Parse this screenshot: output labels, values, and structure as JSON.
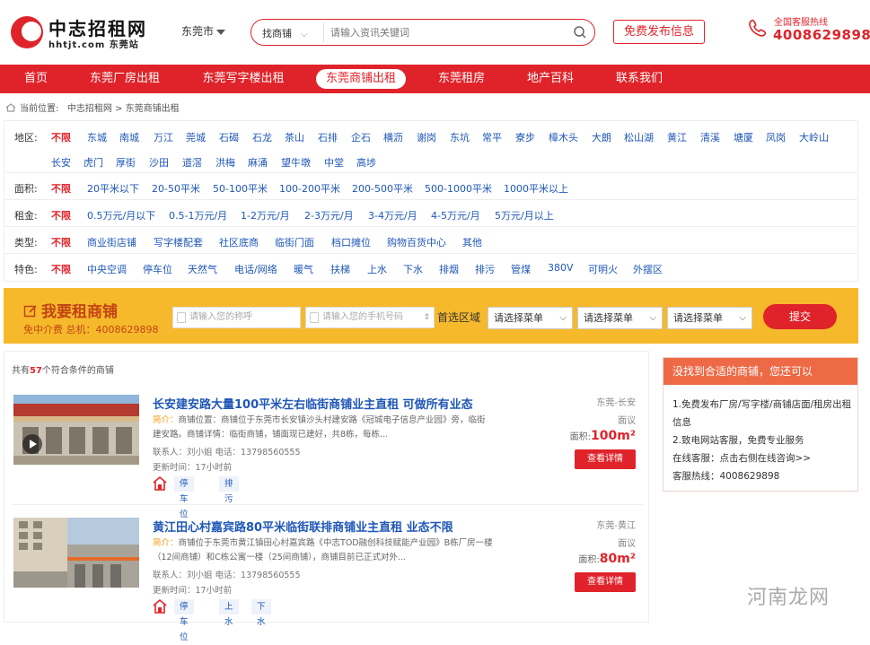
{
  "logo": {
    "title": "中志招租网",
    "sub": "hhtjt.com 东莞站"
  },
  "header": {
    "city": "东莞市",
    "search_type": "找商铺",
    "search_placeholder": "请输入资讯关键词",
    "publish": "免费发布信息",
    "hotline_label": "全国客服热线",
    "hotline": "4008629898"
  },
  "nav": [
    "首页",
    "东莞厂房出租",
    "东莞写字楼出租",
    "东莞商铺出租",
    "东莞租房",
    "地产百科",
    "联系我们"
  ],
  "breadcrumb": {
    "prefix": "当前位置:",
    "home": "中志招租网",
    "sep": ">",
    "current": "东莞商铺出租"
  },
  "filters": {
    "region": {
      "label": "地区:",
      "items": [
        "不限",
        "东城",
        "南城",
        "万江",
        "莞城",
        "石碣",
        "石龙",
        "茶山",
        "石排",
        "企石",
        "横沥",
        "谢岗",
        "东坑",
        "常平",
        "寮步",
        "樟木头",
        "大朗",
        "松山湖",
        "黄江",
        "清溪",
        "塘厦",
        "凤岗",
        "大岭山",
        "长安",
        "虎门",
        "厚街",
        "沙田",
        "道滘",
        "洪梅",
        "麻涌",
        "望牛墩",
        "中堂",
        "高埗"
      ]
    },
    "area": {
      "label": "面积:",
      "items": [
        "不限",
        "20平米以下",
        "20-50平米",
        "50-100平米",
        "100-200平米",
        "200-500平米",
        "500-1000平米",
        "1000平米以上"
      ]
    },
    "rent": {
      "label": "租金:",
      "items": [
        "不限",
        "0.5万元/月以下",
        "0.5-1万元/月",
        "1-2万元/月",
        "2-3万元/月",
        "3-4万元/月",
        "4-5万元/月",
        "5万元/月以上"
      ]
    },
    "type": {
      "label": "类型:",
      "items": [
        "不限",
        "商业街店铺",
        "写字楼配套",
        "社区底商",
        "临街门面",
        "档口摊位",
        "购物百货中心",
        "其他"
      ]
    },
    "feature": {
      "label": "特色:",
      "items": [
        "不限",
        "中央空调",
        "停车位",
        "天然气",
        "电话/网络",
        "暖气",
        "扶梯",
        "上水",
        "下水",
        "排烟",
        "排污",
        "管煤",
        "380V",
        "可明火",
        "外摆区"
      ]
    }
  },
  "banner": {
    "title": "我要租商铺",
    "sub": "免中介费 总机：4008629898",
    "name_ph": "请输入您的称呼",
    "phone_ph": "请输入您的手机号码",
    "region_label": "首选区域",
    "select": "请选择菜单",
    "submit": "提交"
  },
  "list": {
    "count_prefix": "共有",
    "count": "57",
    "count_suffix": "个符合条件的商铺"
  },
  "listings": [
    {
      "title": "长安建安路大量100平米左右临街商铺业主直租 可做所有业态",
      "desc_key": "简介：",
      "desc": "商铺位置：商铺位于东莞市长安镇沙头村建安路《冠城电子信息产业园》旁，临街建安路。商铺详情：临街商铺，铺面现已建好，共8栋，每栋...",
      "contact": "联系人：刘小姐 电话：13798560555",
      "time": "更新时间：17小时前",
      "tags": [
        "停车位",
        "排污"
      ],
      "loc": "东莞-长安",
      "price": "面议",
      "area_label": "面积:",
      "area": "100m²",
      "detail": "查看详情"
    },
    {
      "title": "黄江田心村嘉宾路80平米临街联排商铺业主直租 业态不限",
      "desc_key": "简介：",
      "desc": "商铺位于东莞市黄江镇田心村嘉宾路《中志TOD融创科技赋能产业园》B栋厂房一楼（12间商铺）和C栋公寓一楼（25间商铺），商铺目前已正式对外...",
      "contact": "联系人：刘小姐 电话：13798560555",
      "time": "更新时间：17小时前",
      "tags": [
        "停车位",
        "上水",
        "下水"
      ],
      "loc": "东莞-黄江",
      "price": "面议",
      "area_label": "面积:",
      "area": "80m²",
      "detail": "查看详情"
    }
  ],
  "side": {
    "head": "没找到合适的商铺，您还可以",
    "lines": [
      "1.免费发布厂房/写字楼/商铺店面/租房出租信息",
      "2.致电网站客服，免费专业服务",
      "在线客服：点击右侧在线咨询>>",
      "客服热线：4008629898"
    ]
  },
  "watermark": "河南龙网"
}
